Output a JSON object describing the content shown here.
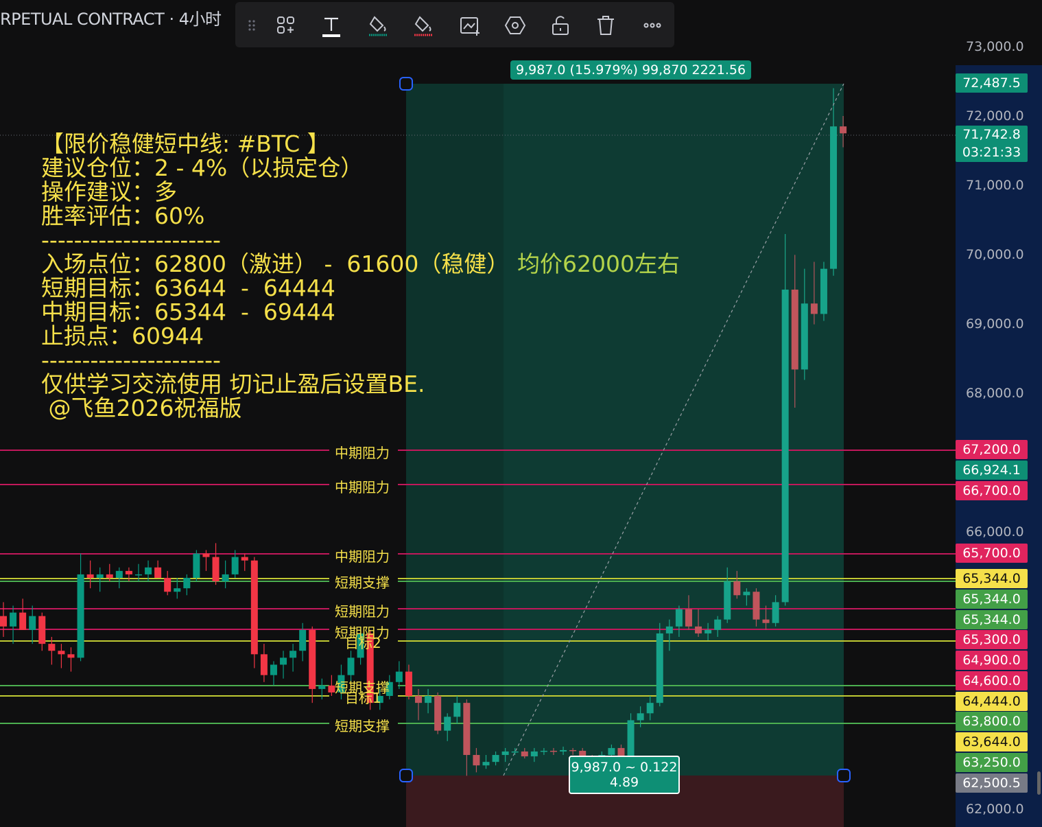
{
  "header": {
    "title": "RPETUAL CONTRACT · 4小时"
  },
  "toolbar": {
    "buttons": [
      "drag-handle-icon",
      "add-group-icon",
      "text-icon",
      "fill-bucket-icon",
      "fill-bucket-alt-icon",
      "image-add-icon",
      "settings-hexagon-icon",
      "unlock-icon",
      "trash-icon",
      "more-icon"
    ]
  },
  "colors": {
    "up": "#089981",
    "down": "#f23645",
    "profit_zone": "#0e3b33",
    "loss_zone": "#3a1a1e",
    "resistance": "#c2185b",
    "support": "#4caf50",
    "target": "#c0ca33"
  },
  "measure": {
    "top_label": "9,987.0 (15.979%) 99,870 2221.56",
    "bottom_label_line1": "9,987.0 ~ 0.122",
    "bottom_label_line2": "4.89"
  },
  "overlay_text": {
    "l1": "【限价稳健短中线: #BTC 】",
    "l2": "建议仓位：2 - 4%（以损定仓）",
    "l3": "操作建议：多",
    "l4": "胜率评估：60%",
    "sep1": "----------------------",
    "l5": "入场点位：62800（激进） -  61600（稳健）",
    "l5b": "均价62000左右",
    "l6": "短期目标：63644  -  64444",
    "l7": "中期目标：65344  -  69444",
    "l8": "止损点：60944",
    "sep2": "----------------------",
    "l9": "仅供学习交流使用 切记止盈后设置BE.",
    "l10": " @飞鱼2026祝福版"
  },
  "hlines": [
    {
      "price": 67200,
      "label": "中期阻力",
      "kind": "resistance"
    },
    {
      "price": 66700,
      "label": "中期阻力",
      "kind": "resistance"
    },
    {
      "price": 65700,
      "label": "中期阻力",
      "kind": "resistance"
    },
    {
      "price": 65344,
      "label": "短期支撑",
      "kind": "target"
    },
    {
      "price": 65344,
      "label": "短期阻力",
      "kind": "support"
    },
    {
      "price": 64900,
      "label": "短期阻力",
      "kind": "resistance"
    },
    {
      "price": 64600,
      "label": "短期阻力",
      "kind": "resistance"
    },
    {
      "price": 65300,
      "label": "短期阻力",
      "kind": "support"
    },
    {
      "price": 64444,
      "label": "目标1",
      "kind": "target"
    },
    {
      "price": 64300,
      "label": "目标2",
      "kind": "target"
    },
    {
      "price": 63800,
      "label": "短期支撑",
      "kind": "support"
    },
    {
      "price": 63250,
      "label": "短期支撑",
      "kind": "support"
    }
  ],
  "price_ticks": [
    "73,000.0",
    "72,000.0",
    "71,000.0",
    "70,000.0",
    "69,000.0",
    "68,000.0",
    "66,000.0",
    "62,000.0"
  ],
  "price_tags": [
    {
      "text": "72,487.5",
      "color": "#0e8f75",
      "fg": "#ffffff"
    },
    {
      "text": "71,742.8",
      "color": "#0e8f75",
      "fg": "#ffffff"
    },
    {
      "text": "03:21:33",
      "color": "#0e8f75",
      "fg": "#ffffff"
    },
    {
      "text": "67,200.0",
      "color": "#e0245e",
      "fg": "#ffffff"
    },
    {
      "text": "66,924.1",
      "color": "#0e8f75",
      "fg": "#ffffff"
    },
    {
      "text": "66,700.0",
      "color": "#e0245e",
      "fg": "#ffffff"
    },
    {
      "text": "65,700.0",
      "color": "#e0245e",
      "fg": "#ffffff"
    },
    {
      "text": "65,344.0",
      "color": "#f5e04a",
      "fg": "#111111"
    },
    {
      "text": "65,344.0",
      "color": "#43a047",
      "fg": "#ffffff"
    },
    {
      "text": "65,344.0",
      "color": "#43a047",
      "fg": "#ffffff"
    },
    {
      "text": "65,300.0",
      "color": "#e0245e",
      "fg": "#ffffff"
    },
    {
      "text": "64,900.0",
      "color": "#e0245e",
      "fg": "#ffffff"
    },
    {
      "text": "64,600.0",
      "color": "#e0245e",
      "fg": "#ffffff"
    },
    {
      "text": "64,444.0",
      "color": "#f5e04a",
      "fg": "#111111"
    },
    {
      "text": "63,800.0",
      "color": "#43a047",
      "fg": "#ffffff"
    },
    {
      "text": "63,644.0",
      "color": "#f5e04a",
      "fg": "#111111"
    },
    {
      "text": "63,250.0",
      "color": "#43a047",
      "fg": "#ffffff"
    },
    {
      "text": "62,500.5",
      "color": "#787b86",
      "fg": "#ffffff"
    }
  ],
  "candles": [
    [
      64800,
      65000,
      64500,
      64650
    ],
    [
      64650,
      64950,
      64400,
      64850
    ],
    [
      64850,
      65050,
      64600,
      64600
    ],
    [
      64600,
      64950,
      64400,
      64800
    ],
    [
      64800,
      64850,
      64300,
      64400
    ],
    [
      64400,
      64500,
      64100,
      64300
    ],
    [
      64300,
      64400,
      64050,
      64250
    ],
    [
      64250,
      64350,
      64000,
      64200
    ],
    [
      64200,
      65700,
      64150,
      65400
    ],
    [
      65400,
      65600,
      65200,
      65350
    ],
    [
      65350,
      65500,
      65150,
      65400
    ],
    [
      65400,
      65550,
      65300,
      65350
    ],
    [
      65350,
      65500,
      65200,
      65450
    ],
    [
      65450,
      65500,
      65300,
      65400
    ],
    [
      65400,
      65550,
      65300,
      65400
    ],
    [
      65400,
      65600,
      65300,
      65500
    ],
    [
      65500,
      65600,
      65350,
      65350
    ],
    [
      65350,
      65450,
      65100,
      65150
    ],
    [
      65150,
      65350,
      65050,
      65200
    ],
    [
      65200,
      65400,
      65100,
      65350
    ],
    [
      65350,
      65750,
      65300,
      65700
    ],
    [
      65700,
      65750,
      65450,
      65650
    ],
    [
      65650,
      65850,
      65250,
      65300
    ],
    [
      65300,
      65600,
      65200,
      65400
    ],
    [
      65400,
      65750,
      65350,
      65650
    ],
    [
      65650,
      65700,
      65450,
      65600
    ],
    [
      65600,
      65650,
      64050,
      64250
    ],
    [
      64250,
      64400,
      63850,
      63950
    ],
    [
      63950,
      64150,
      63800,
      64100
    ],
    [
      64100,
      64300,
      63900,
      64200
    ],
    [
      64200,
      64400,
      64000,
      64300
    ],
    [
      64300,
      64700,
      64150,
      64600
    ],
    [
      64600,
      64650,
      63550,
      63750
    ],
    [
      63750,
      63900,
      63600,
      63800
    ],
    [
      63800,
      63950,
      63650,
      63700
    ],
    [
      63700,
      64100,
      63600,
      63950
    ],
    [
      63950,
      64300,
      63850,
      64200
    ],
    [
      64200,
      64650,
      64100,
      64550
    ],
    [
      64550,
      64600,
      63450,
      63550
    ],
    [
      63550,
      63750,
      63450,
      63650
    ],
    [
      63650,
      63950,
      63600,
      63850
    ],
    [
      63850,
      64150,
      63750,
      64000
    ],
    [
      64000,
      64100,
      63600,
      63650
    ],
    [
      63650,
      63750,
      63300,
      63550
    ],
    [
      63550,
      63750,
      63400,
      63650
    ],
    [
      63650,
      63700,
      63100,
      63150
    ],
    [
      63150,
      63400,
      63000,
      63350
    ],
    [
      63350,
      63650,
      63250,
      63550
    ],
    [
      63550,
      63600,
      62500,
      62800
    ],
    [
      62800,
      62900,
      62550,
      62650
    ],
    [
      62650,
      62800,
      62600,
      62700
    ],
    [
      62700,
      62850,
      62650,
      62800
    ],
    [
      62800,
      62900,
      62700,
      62850
    ],
    [
      62850,
      62900,
      62800,
      62850
    ],
    [
      62850,
      62900,
      62750,
      62780
    ],
    [
      62780,
      62900,
      62700,
      62850
    ],
    [
      62850,
      62900,
      62800,
      62860
    ],
    [
      62860,
      62900,
      62800,
      62850
    ],
    [
      62850,
      62920,
      62800,
      62870
    ],
    [
      62870,
      62900,
      62800,
      62860
    ],
    [
      62860,
      62900,
      62750,
      62780
    ],
    [
      62780,
      62800,
      62700,
      62720
    ],
    [
      62720,
      62850,
      62700,
      62800
    ],
    [
      62800,
      62950,
      62700,
      62900
    ],
    [
      62900,
      62950,
      62700,
      62720
    ],
    [
      62720,
      63400,
      62650,
      63300
    ],
    [
      63300,
      63500,
      63200,
      63400
    ],
    [
      63400,
      63650,
      63300,
      63550
    ],
    [
      63550,
      64700,
      63500,
      64550
    ],
    [
      64550,
      64750,
      64300,
      64650
    ],
    [
      64650,
      64950,
      64500,
      64900
    ],
    [
      64900,
      65100,
      64600,
      64650
    ],
    [
      64650,
      64900,
      64500,
      64550
    ],
    [
      64550,
      64700,
      64450,
      64600
    ],
    [
      64600,
      64800,
      64500,
      64750
    ],
    [
      64750,
      65500,
      64700,
      65300
    ],
    [
      65300,
      65450,
      65050,
      65100
    ],
    [
      65100,
      65200,
      64950,
      65150
    ],
    [
      65150,
      65200,
      64650,
      64750
    ],
    [
      64750,
      64950,
      64600,
      64700
    ],
    [
      64700,
      65100,
      64650,
      65000
    ],
    [
      65000,
      70300,
      64950,
      69500
    ],
    [
      69500,
      70000,
      67800,
      68350
    ],
    [
      68350,
      69800,
      68200,
      69300
    ],
    [
      69300,
      69900,
      69000,
      69150
    ],
    [
      69150,
      69900,
      69050,
      69800
    ],
    [
      69800,
      72400,
      69700,
      71850
    ],
    [
      71850,
      72000,
      71550,
      71750
    ]
  ]
}
